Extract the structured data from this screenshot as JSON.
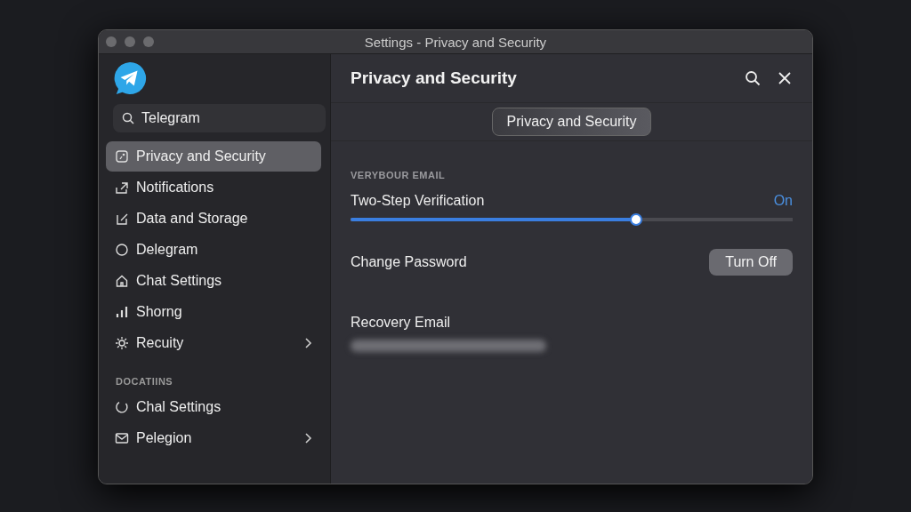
{
  "window": {
    "title": "Settings - Privacy and Security"
  },
  "sidebar": {
    "search": {
      "value": "Telegram"
    },
    "items": [
      {
        "label": "Privacy and Security",
        "selected": true,
        "chevron": false
      },
      {
        "label": "Notifications",
        "selected": false,
        "chevron": false
      },
      {
        "label": "Data and Storage",
        "selected": false,
        "chevron": false
      },
      {
        "label": "Delegram",
        "selected": false,
        "chevron": false
      },
      {
        "label": "Chat Settings",
        "selected": false,
        "chevron": false
      },
      {
        "label": "Shorng",
        "selected": false,
        "chevron": false
      },
      {
        "label": "Recuity",
        "selected": false,
        "chevron": true
      }
    ],
    "section": {
      "header": "DOCATIINS",
      "items": [
        {
          "label": "Chal Settings",
          "selected": false,
          "chevron": false
        },
        {
          "label": "Pelegion",
          "selected": false,
          "chevron": true
        }
      ]
    }
  },
  "content": {
    "title": "Privacy and Security",
    "tab": "Privacy and Security",
    "section_header": "VERYBOUR EMAIL",
    "slider": {
      "label": "Two-Step Verification",
      "reading": "On",
      "level": 0.646
    },
    "password": {
      "label": "Change Password",
      "button": "Turn Off"
    },
    "recovery": {
      "label": "Recovery Email"
    }
  }
}
